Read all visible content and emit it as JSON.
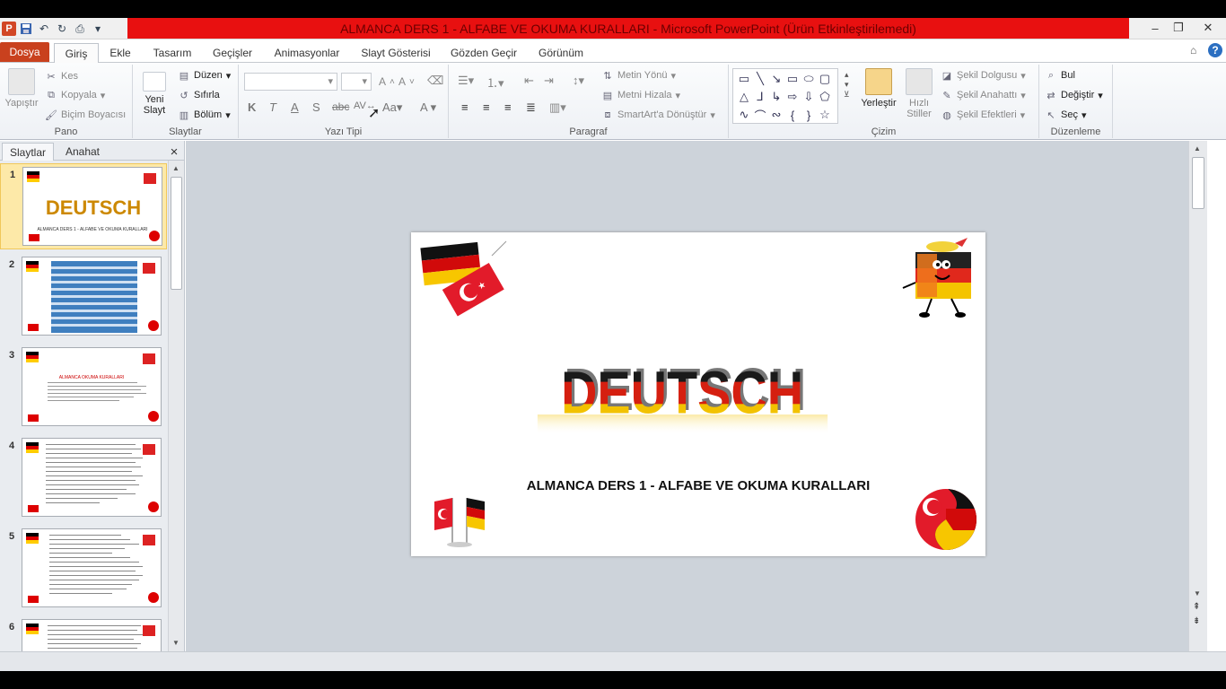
{
  "window": {
    "title": "ALMANCA DERS 1 - ALFABE VE OKUMA KURALLARI  -  Microsoft PowerPoint (Ürün Etkinleştirilemedi)",
    "app_icon_letter": "P"
  },
  "tabs": [
    "Dosya",
    "Giriş",
    "Ekle",
    "Tasarım",
    "Geçişler",
    "Animasyonlar",
    "Slayt Gösterisi",
    "Gözden Geçir",
    "Görünüm"
  ],
  "ribbon": {
    "pano": {
      "label": "Pano",
      "paste": "Yapıştır",
      "cut": "Kes",
      "copy": "Kopyala",
      "format_painter": "Biçim Boyacısı"
    },
    "slaytlar": {
      "label": "Slaytlar",
      "new_slide_line1": "Yeni",
      "new_slide_line2": "Slayt",
      "layout": "Düzen",
      "reset": "Sıfırla",
      "section": "Bölüm"
    },
    "yazi_tipi": {
      "label": "Yazı Tipi"
    },
    "paragraf": {
      "label": "Paragraf",
      "text_direction": "Metin Yönü",
      "align_text": "Metni Hizala",
      "smartart": "SmartArt'a Dönüştür"
    },
    "cizim": {
      "label": "Çizim",
      "arrange": "Yerleştir",
      "quick_styles_line1": "Hızlı",
      "quick_styles_line2": "Stiller",
      "shape_fill": "Şekil Dolgusu",
      "shape_outline": "Şekil Anahattı",
      "shape_effects": "Şekil Efektleri"
    },
    "duzenleme": {
      "label": "Düzenleme",
      "find": "Bul",
      "replace": "Değiştir",
      "select": "Seç"
    }
  },
  "pane": {
    "tab_slides": "Slaytlar",
    "tab_outline": "Anahat",
    "close": "×"
  },
  "thumbnails": [
    {
      "num": "1",
      "title": "ALMANCA DERS 1 - ALFABE VE OKUMA KURALLARI"
    },
    {
      "num": "2"
    },
    {
      "num": "3",
      "title": "ALMANCA OKUMA KURALLARI"
    },
    {
      "num": "4"
    },
    {
      "num": "5"
    },
    {
      "num": "6"
    }
  ],
  "slide": {
    "logo_text": "DEUTSCH",
    "title": "ALMANCA DERS 1 - ALFABE VE OKUMA KURALLARI"
  },
  "colors": {
    "title_bar": "#e81010",
    "file_tab": "#c9411e",
    "selected_thumb": "#fde9a8",
    "slide_bg": "#ffffff",
    "workspace": "#cdd3da"
  }
}
